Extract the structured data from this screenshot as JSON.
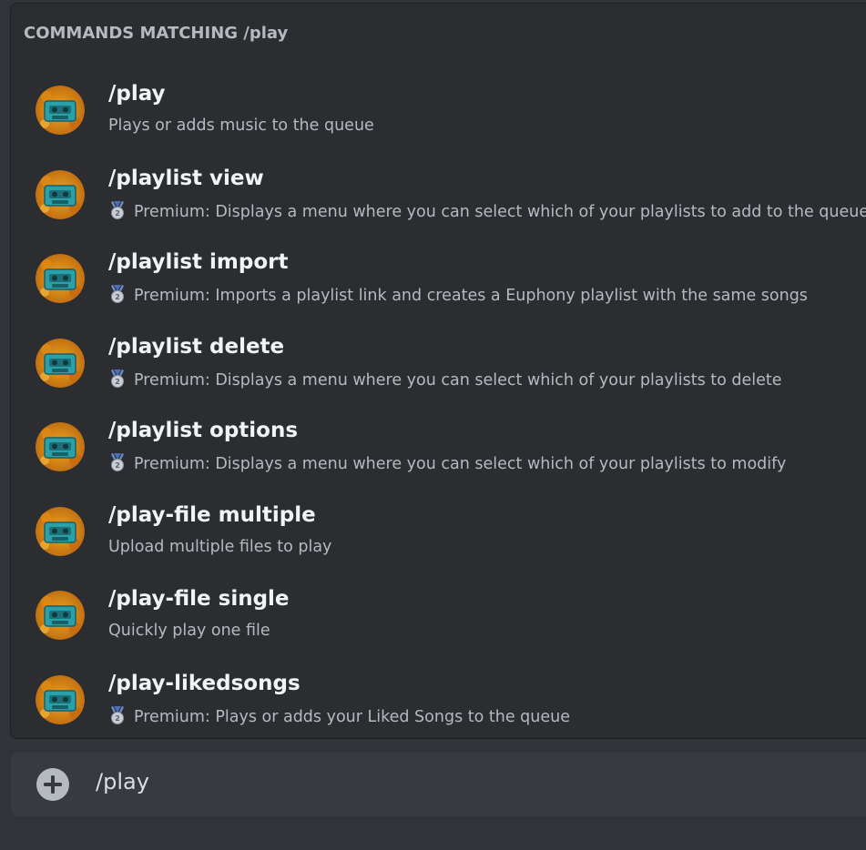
{
  "popup": {
    "header": "COMMANDS MATCHING /play",
    "commands": [
      {
        "name": "/play",
        "premium": false,
        "description": "Plays or adds music to the queue"
      },
      {
        "name": "/playlist view",
        "premium": true,
        "description": "Premium: Displays a menu where you can select which of your playlists to add to the queue"
      },
      {
        "name": "/playlist import",
        "premium": true,
        "description": "Premium: Imports a playlist link and creates a Euphony playlist with the same songs"
      },
      {
        "name": "/playlist delete",
        "premium": true,
        "description": "Premium: Displays a menu where you can select which of your playlists to delete"
      },
      {
        "name": "/playlist options",
        "premium": true,
        "description": "Premium: Displays a menu where you can select which of your playlists to modify"
      },
      {
        "name": "/play-file multiple",
        "premium": false,
        "description": "Upload multiple files to play"
      },
      {
        "name": "/play-file single",
        "premium": false,
        "description": "Quickly play one file"
      },
      {
        "name": "/play-likedsongs",
        "premium": true,
        "description": "Premium: Plays or adds your Liked Songs to the queue"
      }
    ]
  },
  "chat": {
    "input_value": "/play",
    "attach_icon": "plus-circle-icon"
  },
  "icons": {
    "bot_avatar": "cassette-tape-avatar-icon",
    "premium_badge": "silver-medal-icon"
  },
  "colors": {
    "background": "#313338",
    "popup": "#2b2d31",
    "input_bar": "#383a40",
    "text_primary": "#f2f3f5",
    "text_secondary": "#b5bac1"
  }
}
